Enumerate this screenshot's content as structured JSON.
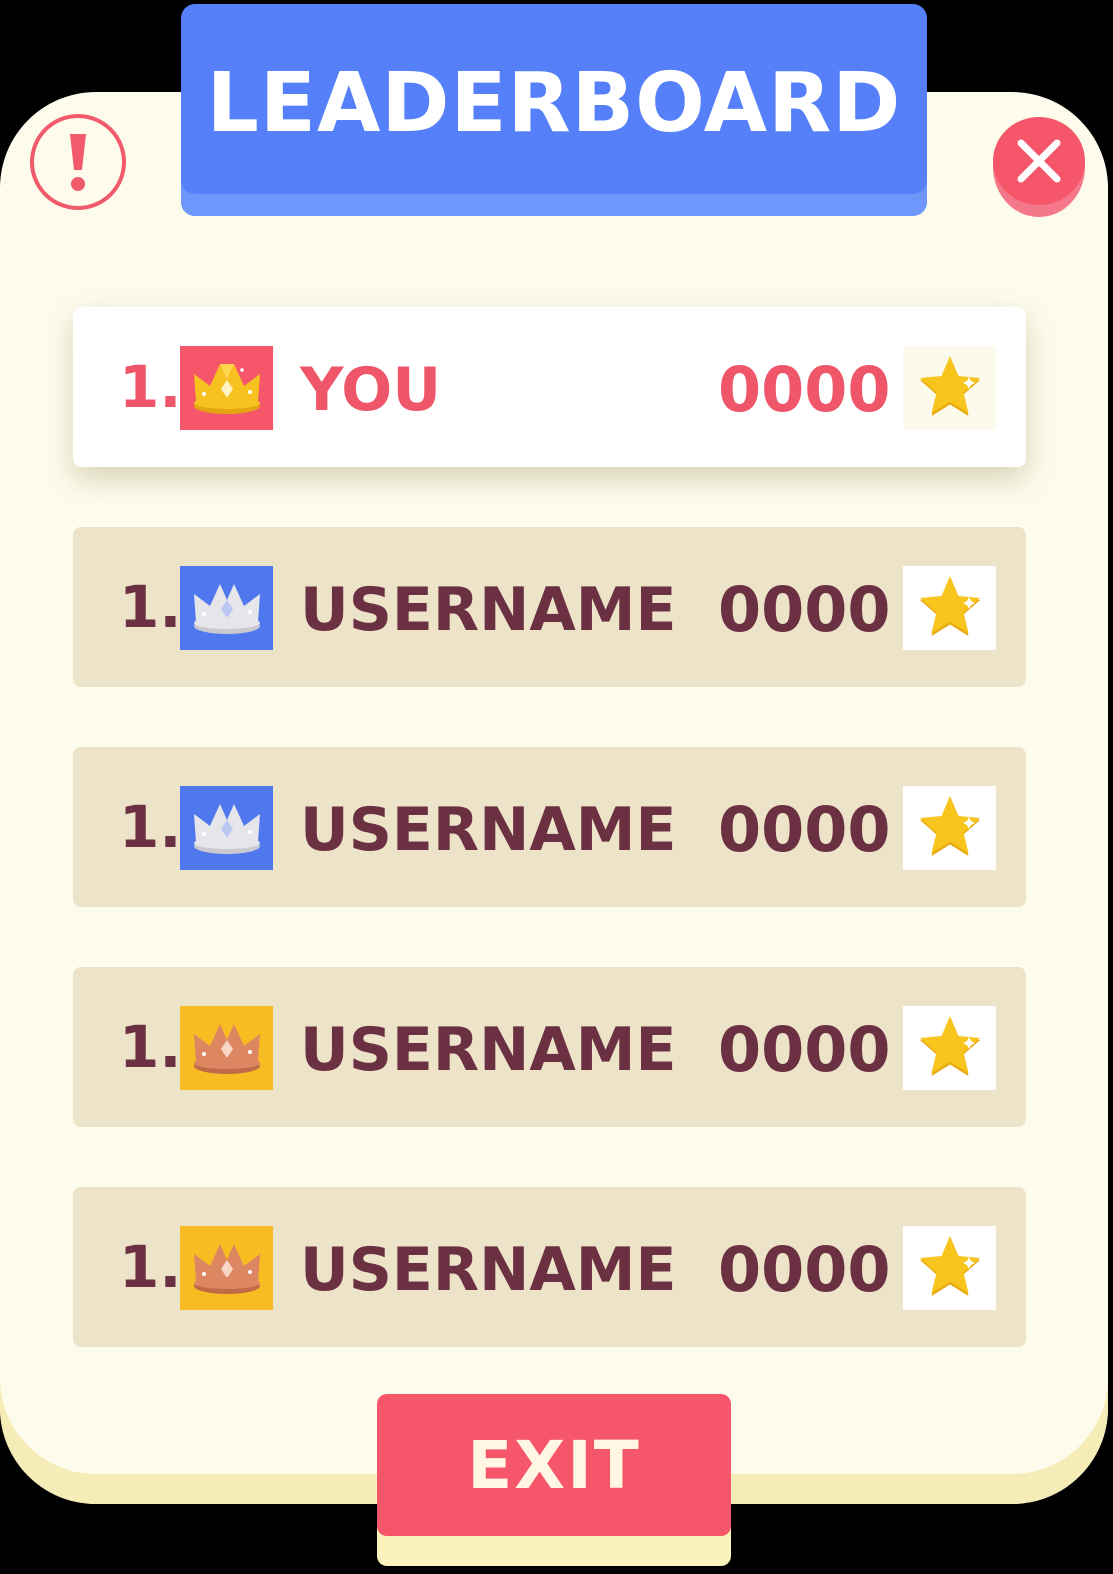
{
  "header": {
    "title": "LEADERBOARD"
  },
  "icons": {
    "info": "info-exclamation-icon",
    "close": "close-x-icon",
    "star": "star-icon",
    "crown": "crown-icon"
  },
  "colors": {
    "panel": "#fdfbec",
    "banner": "#5680fa",
    "accent_red": "#f5566a",
    "row_bg": "#ece3c8",
    "text_dark": "#6b3142",
    "gold": "#f7c21f",
    "silver_badge": "#4f78ee",
    "bronze_badge": "#f6bc22"
  },
  "rows": [
    {
      "rank": "1.",
      "name": "YOU",
      "score": "0000",
      "badge": "gold",
      "highlight": true
    },
    {
      "rank": "1.",
      "name": "USERNAME",
      "score": "0000",
      "badge": "silver",
      "highlight": false
    },
    {
      "rank": "1.",
      "name": "USERNAME",
      "score": "0000",
      "badge": "silver",
      "highlight": false
    },
    {
      "rank": "1.",
      "name": "USERNAME",
      "score": "0000",
      "badge": "bronze",
      "highlight": false
    },
    {
      "rank": "1.",
      "name": "USERNAME",
      "score": "0000",
      "badge": "bronze",
      "highlight": false
    }
  ],
  "footer": {
    "exit_label": "EXIT"
  }
}
